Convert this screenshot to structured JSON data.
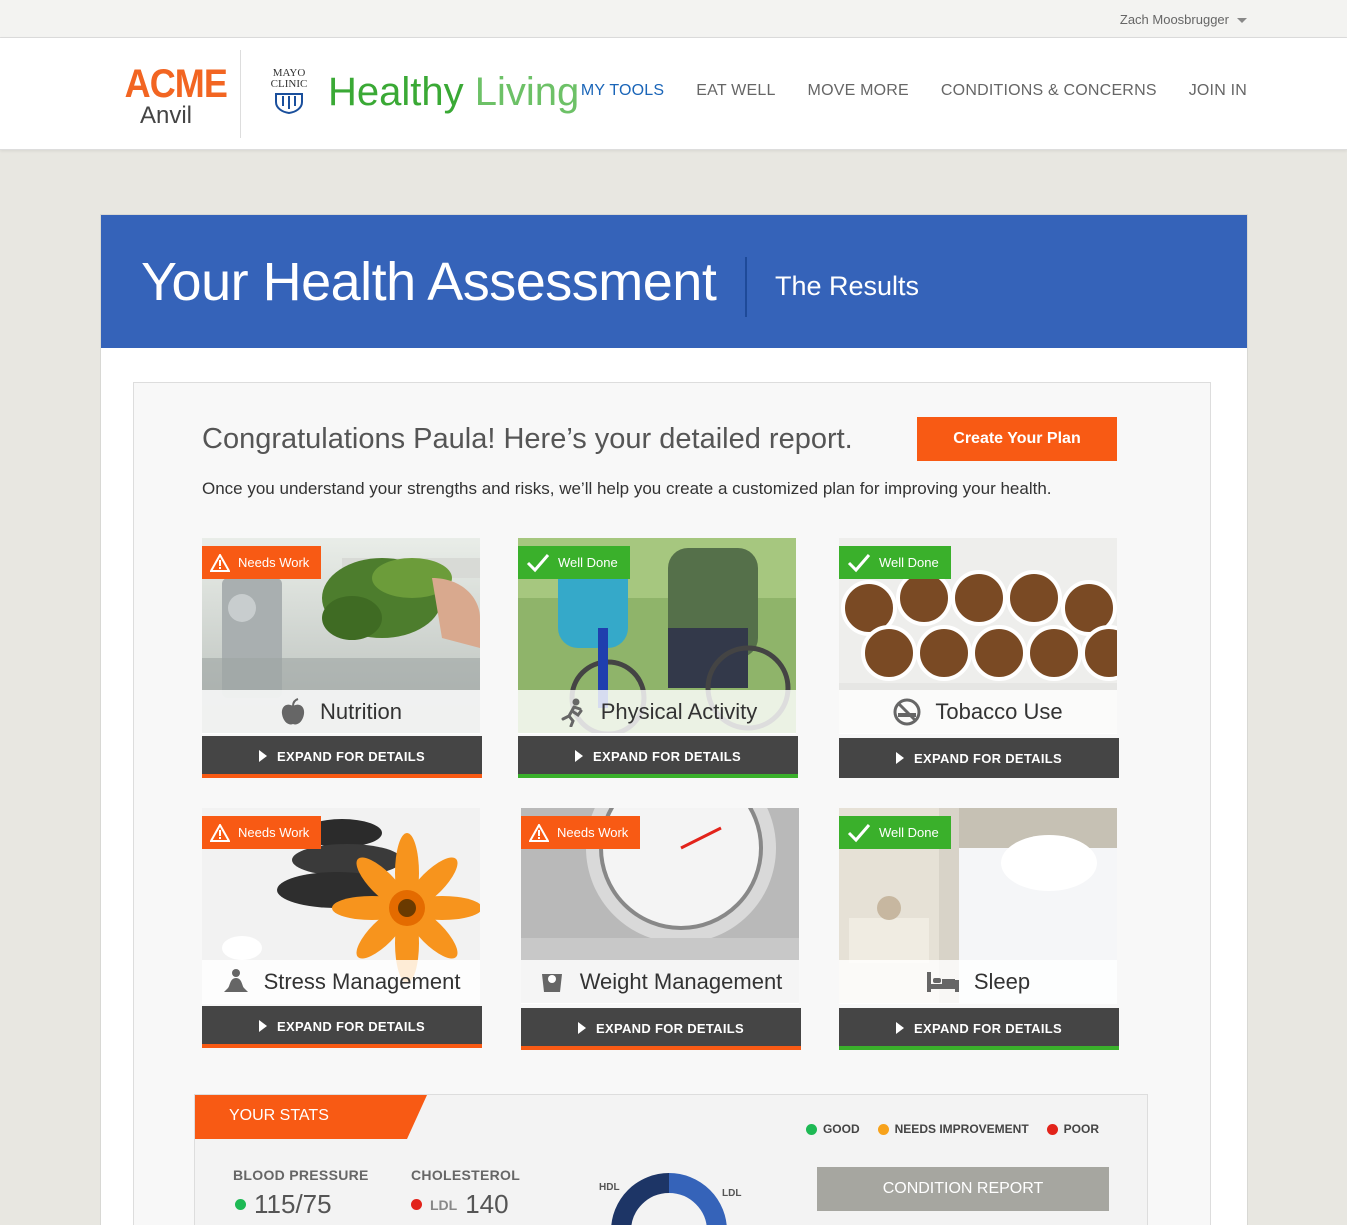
{
  "user": {
    "name": "Zach Moosbrugger"
  },
  "brand": {
    "acme_top": "ACME",
    "acme_bottom": "Anvil",
    "mayo_line1": "MAYO",
    "mayo_line2": "CLINIC",
    "product_bold": "Healthy",
    "product_light": "Living"
  },
  "nav": [
    {
      "label": "MY TOOLS"
    },
    {
      "label": "EAT WELL"
    },
    {
      "label": "MOVE MORE"
    },
    {
      "label": "CONDITIONS & CONCERNS"
    },
    {
      "label": "JOIN IN"
    }
  ],
  "banner": {
    "title": "Your Health Assessment",
    "subtitle": "The Results"
  },
  "report": {
    "heading": "Congratulations Paula! Here’s your detailed report.",
    "plan_button": "Create Your Plan",
    "intro": "Once you understand your strengths and risks, we’ll help you create a customized plan for improving your health."
  },
  "expand_label": "EXPAND FOR DETAILS",
  "cards": [
    {
      "title": "Nutrition",
      "status": "Needs Work",
      "icon": "apple-icon"
    },
    {
      "title": "Physical Activity",
      "status": "Well Done",
      "icon": "running-icon"
    },
    {
      "title": "Tobacco Use",
      "status": "Well Done",
      "icon": "no-smoking-icon"
    },
    {
      "title": "Stress Management",
      "status": "Needs Work",
      "icon": "meditation-icon"
    },
    {
      "title": "Weight Management",
      "status": "Needs Work",
      "icon": "scale-icon"
    },
    {
      "title": "Sleep",
      "status": "Well Done",
      "icon": "bed-icon"
    }
  ],
  "colors": {
    "needs_work": "#f85a14",
    "well_done": "#3ab02b",
    "banner": "#3563b9",
    "nav_active": "#1a65b8"
  },
  "stats": {
    "tab_label": "YOUR STATS",
    "legend": [
      {
        "label": "GOOD",
        "color": "#1db954"
      },
      {
        "label": "NEEDS IMPROVEMENT",
        "color": "#f7a21b"
      },
      {
        "label": "POOR",
        "color": "#e2231a"
      }
    ],
    "blood_pressure": {
      "label": "BLOOD PRESSURE",
      "value": "115/75",
      "status_color": "#1db954"
    },
    "cholesterol": {
      "label": "CHOLESTEROL",
      "prefix": "LDL",
      "value": "140",
      "status_color": "#e2231a"
    },
    "donut": {
      "left_label": "HDL",
      "right_label": "LDL"
    },
    "condition_button": "CONDITION REPORT"
  }
}
